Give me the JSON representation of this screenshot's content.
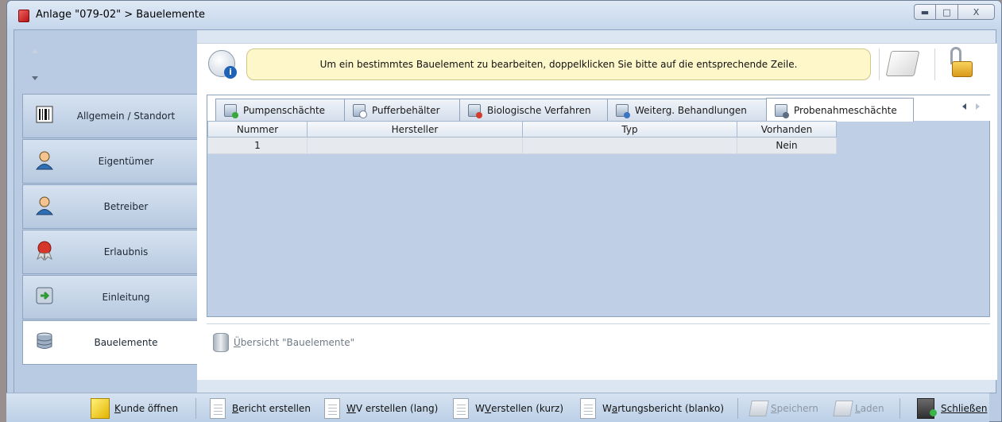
{
  "window": {
    "title": "Anlage \"079-02\" > Bauelemente",
    "minimize_icon": "minimize-icon",
    "maximize_icon": "maximize-icon",
    "close_symbol": "X"
  },
  "nav": {
    "items": [
      {
        "label": "Allgemein / Standort",
        "icon": "barcode-icon"
      },
      {
        "label": "Eigentümer",
        "icon": "person-icon"
      },
      {
        "label": "Betreiber",
        "icon": "person-icon"
      },
      {
        "label": "Erlaubnis",
        "icon": "seal-icon"
      },
      {
        "label": "Einleitung",
        "icon": "database-arrow-icon"
      },
      {
        "label": "Bauelemente",
        "icon": "database-icon"
      }
    ],
    "active": "Bauelemente"
  },
  "info": {
    "message": "Um ein bestimmtes Bauelement zu bearbeiten, doppelklicken Sie bitte auf die entsprechende Zeile."
  },
  "tabs": [
    {
      "label": "Pumpenschächte"
    },
    {
      "label": "Pufferbehälter"
    },
    {
      "label": "Biologische Verfahren"
    },
    {
      "label": "Weiterg. Behandlungen"
    },
    {
      "label": "Probenahmeschächte"
    }
  ],
  "active_tab": "Probenahmeschächte",
  "table": {
    "columns": [
      "Nummer",
      "Hersteller",
      "Typ",
      "Vorhanden"
    ],
    "rows": [
      [
        "1",
        "",
        "",
        "Nein"
      ]
    ]
  },
  "overview": {
    "label_prefix": "Ü",
    "label_rest": "bersicht \"Bauelemente\""
  },
  "toolbar": {
    "kunde_oeffnen": {
      "accel": "K",
      "rest": "unde öffnen"
    },
    "bericht_erstellen": {
      "accel": "B",
      "rest": "ericht erstellen"
    },
    "wv_lang": {
      "pre": "",
      "accel": "W",
      "rest": "V erstellen (lang)"
    },
    "wv_kurz": {
      "pre": "W",
      "accel": "V",
      "rest": " erstellen (kurz)"
    },
    "wartungsbericht": {
      "pre": "W",
      "accel": "a",
      "rest": "rtungsbericht (blanko)"
    },
    "speichern": {
      "accel": "S",
      "rest": "peichern"
    },
    "laden": {
      "accel": "L",
      "rest": "aden"
    },
    "schliessen": {
      "accel": "S",
      "rest": "chließen"
    }
  }
}
